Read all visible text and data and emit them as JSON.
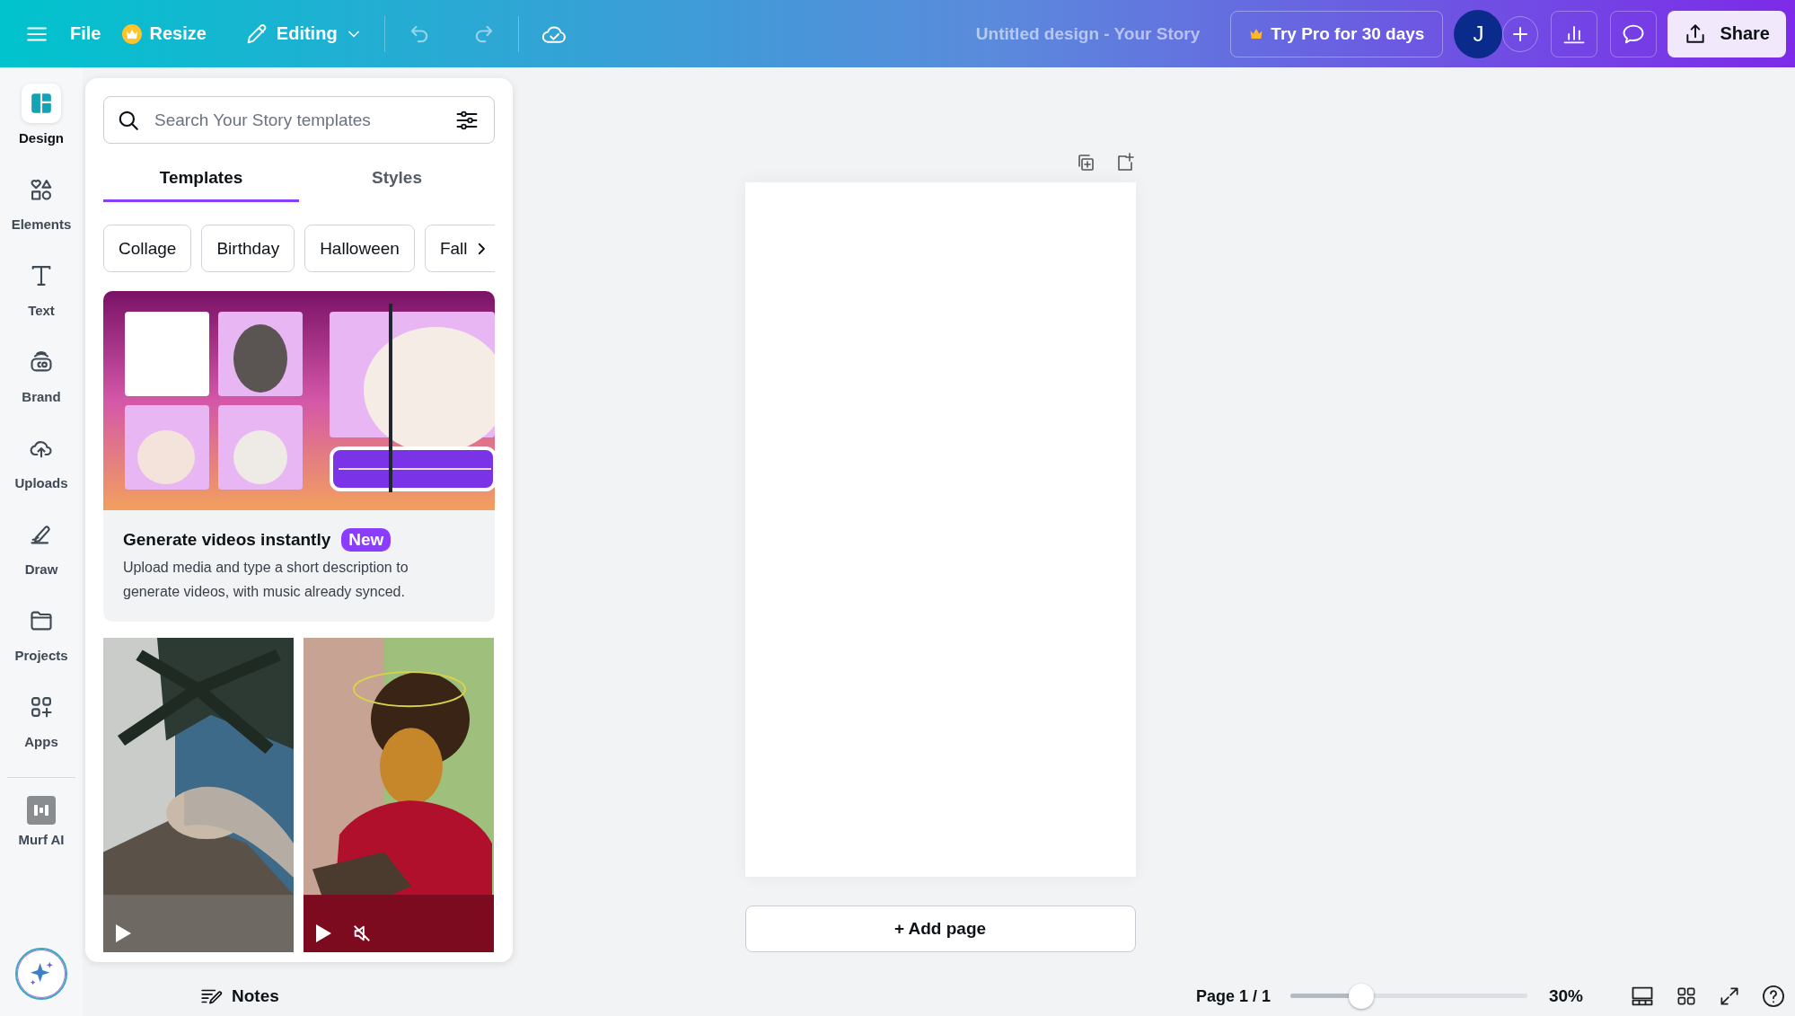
{
  "topbar": {
    "menu": [
      {
        "label": "File",
        "kind": "plain"
      },
      {
        "label": "Resize",
        "kind": "pro"
      }
    ],
    "mode": "Editing",
    "title": "Untitled design - Your Story",
    "trial": "Try Pro for 30 days",
    "avatar": "J",
    "share": "Share"
  },
  "rail": [
    {
      "label": "Design",
      "selected": true
    },
    {
      "label": "Elements",
      "selected": false
    },
    {
      "label": "Text",
      "selected": false
    },
    {
      "label": "Brand",
      "selected": false
    },
    {
      "label": "Uploads",
      "selected": false
    },
    {
      "label": "Draw",
      "selected": false
    },
    {
      "label": "Projects",
      "selected": false
    },
    {
      "label": "Apps",
      "selected": false
    }
  ],
  "rail_app": {
    "label": "Murf AI"
  },
  "panel": {
    "search": {
      "placeholder": "Search Your Story templates"
    },
    "tabs": [
      {
        "label": "Templates",
        "selected": true
      },
      {
        "label": "Styles",
        "selected": false
      }
    ],
    "chips": [
      "Collage",
      "Birthday",
      "Halloween",
      "Fall"
    ],
    "promo": {
      "title": "Generate videos instantly",
      "badge": "New",
      "text": "Upload media and type a short description to generate videos, with music already synced."
    }
  },
  "canvas": {
    "add_page": "+ Add page"
  },
  "footer": {
    "notes": "Notes",
    "page": "Page 1 / 1",
    "zoom": {
      "level": 0.3
    },
    "zoom_reading": "30%"
  }
}
